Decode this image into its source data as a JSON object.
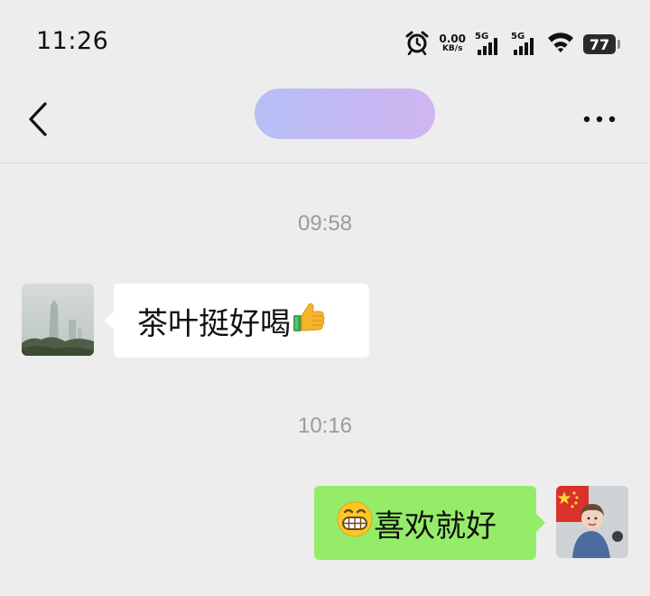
{
  "status_bar": {
    "time": "11:26",
    "net_speed_value": "0.00",
    "net_speed_unit": "KB/s",
    "signal_1_label": "5G",
    "signal_2_label": "5G",
    "battery_level": "77",
    "icons": [
      "alarm-icon",
      "cellular-signal-icon",
      "wifi-icon",
      "battery-icon"
    ]
  },
  "nav": {
    "back_icon": "chevron-left-icon",
    "more_icon": "more-horizontal-icon",
    "title_blur_colors": [
      "#b6bff6",
      "#cfb6f1"
    ]
  },
  "chat": {
    "messages": [
      {
        "timestamp": "09:58",
        "direction": "incoming",
        "text": "茶叶挺好喝",
        "emoji": "thumbs-up-emoji",
        "bubble_color": "#ffffff"
      },
      {
        "timestamp": "10:16",
        "direction": "outgoing",
        "emoji": "grinning-face-emoji",
        "text": "喜欢就好",
        "bubble_color": "#95ec69"
      }
    ]
  },
  "colors": {
    "background": "#ededed",
    "timestamp_text": "#9b9b9b",
    "outgoing_bubble": "#95ec69",
    "incoming_bubble": "#ffffff"
  }
}
